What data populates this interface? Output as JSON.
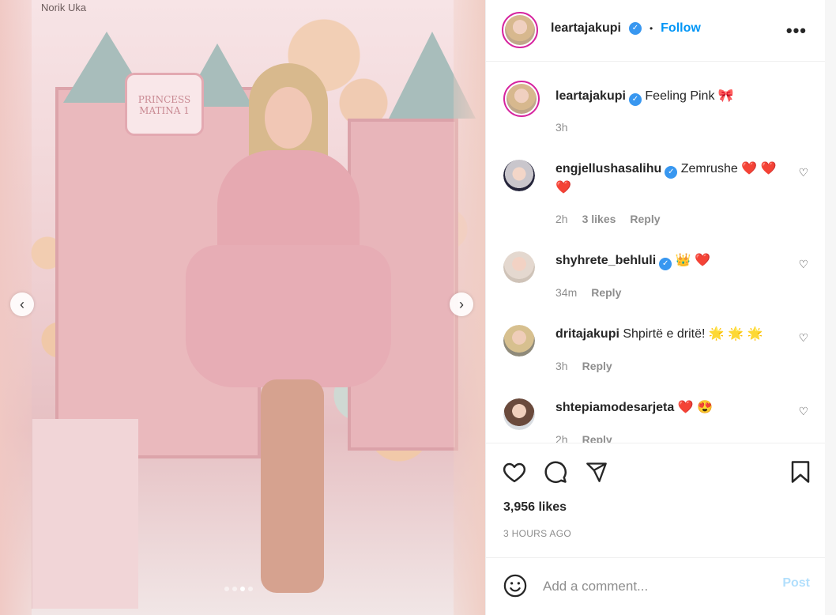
{
  "media": {
    "watermark": "Norik Uka",
    "sign_line1": "PRINCESS",
    "sign_line2": "MATINA 1",
    "dots": 4,
    "active_dot": 2
  },
  "header": {
    "username": "leartajakupi",
    "follow": "Follow",
    "more": "•••"
  },
  "caption": {
    "username": "leartajakupi",
    "text": "Feeling Pink 🎀",
    "time": "3h"
  },
  "comments": [
    {
      "username": "engjellushasalihu",
      "verified": true,
      "text": "Zemrushe ❤️ ❤️ ❤️",
      "time": "2h",
      "likes": "3 likes",
      "reply": "Reply"
    },
    {
      "username": "shyhrete_behluli",
      "verified": true,
      "text": "👑 ❤️",
      "time": "34m",
      "likes": "",
      "reply": "Reply"
    },
    {
      "username": "dritajakupi",
      "verified": false,
      "text": "Shpirtë e dritë! 🌟 🌟 🌟",
      "time": "3h",
      "likes": "",
      "reply": "Reply"
    },
    {
      "username": "shtepiamodesarjeta",
      "verified": false,
      "text": "❤️ 😍",
      "time": "2h",
      "likes": "",
      "reply": "Reply"
    }
  ],
  "stats": {
    "likes": "3,956 likes",
    "time": "3 HOURS AGO"
  },
  "add_comment": {
    "placeholder": "Add a comment...",
    "post": "Post"
  },
  "colors": {
    "link": "#0095f6",
    "verified": "#3897f0",
    "muted": "#8e8e8e"
  }
}
